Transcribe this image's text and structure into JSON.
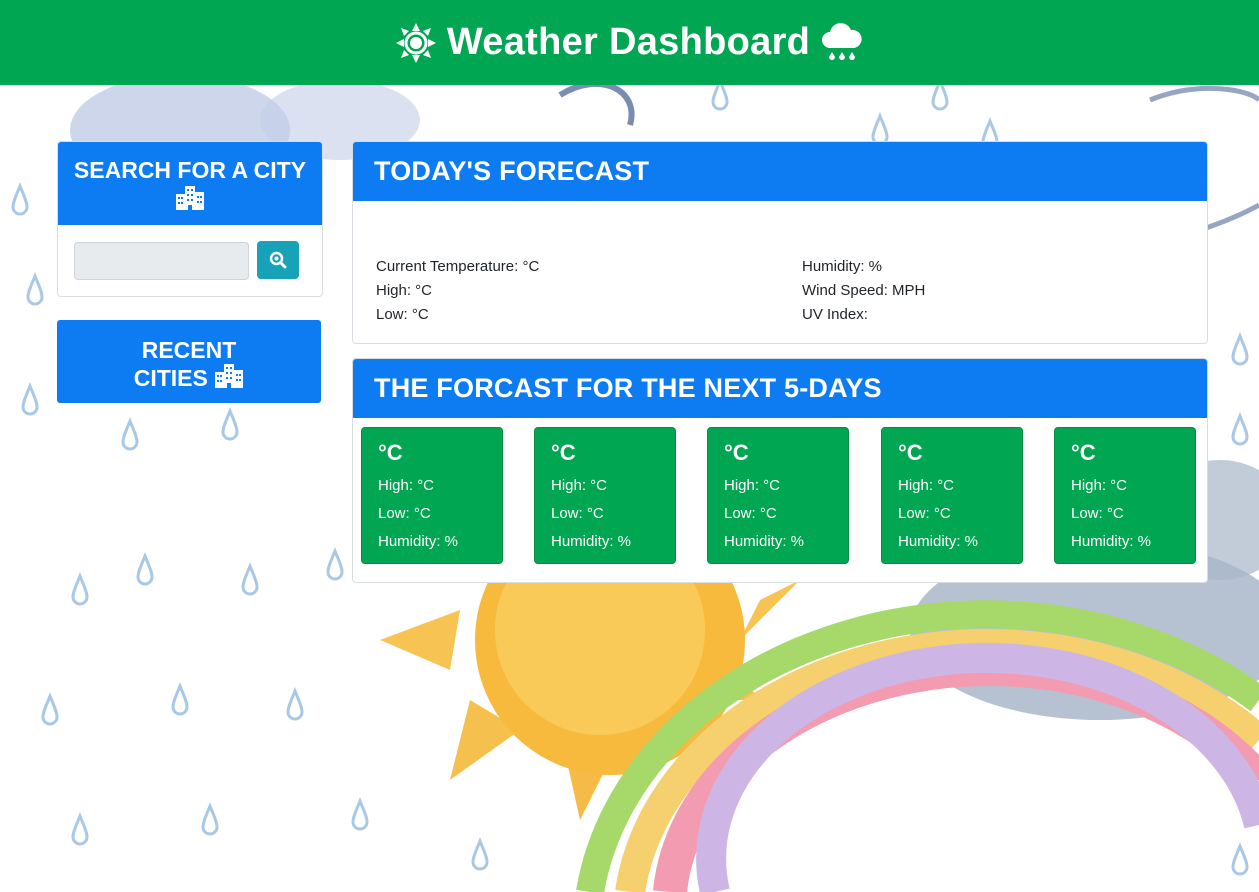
{
  "header": {
    "title": "Weather Dashboard",
    "left_icon": "sun-icon",
    "right_icon": "rain-cloud-icon"
  },
  "search": {
    "heading": "SEARCH FOR A CITY",
    "heading_icon": "city-icon",
    "input_value": "",
    "button_icon": "search-icon"
  },
  "recent": {
    "line1": "RECENT",
    "line2": "CITIES",
    "icon": "city-icon"
  },
  "today": {
    "heading": "TODAY'S FORECAST",
    "current_temp": "Current Temperature: °C",
    "high": "High: °C",
    "low": "Low: °C",
    "humidity": "Humidity: %",
    "wind": "Wind Speed: MPH",
    "uv": "UV Index:"
  },
  "five_day": {
    "heading": "THE FORCAST FOR THE NEXT 5-DAYS",
    "days": [
      {
        "temp": "°C",
        "high": "High: °C",
        "low": "Low: °C",
        "humidity": "Humidity: %"
      },
      {
        "temp": "°C",
        "high": "High: °C",
        "low": "Low: °C",
        "humidity": "Humidity: %"
      },
      {
        "temp": "°C",
        "high": "High: °C",
        "low": "Low: °C",
        "humidity": "Humidity: %"
      },
      {
        "temp": "°C",
        "high": "High: °C",
        "low": "Low: °C",
        "humidity": "Humidity: %"
      },
      {
        "temp": "°C",
        "high": "High: °C",
        "low": "Low: °C",
        "humidity": "Humidity: %"
      }
    ]
  },
  "colors": {
    "header_green": "#00a651",
    "panel_blue": "#0d7cf2",
    "button_teal": "#17a2b8",
    "card_green": "#00a651"
  }
}
